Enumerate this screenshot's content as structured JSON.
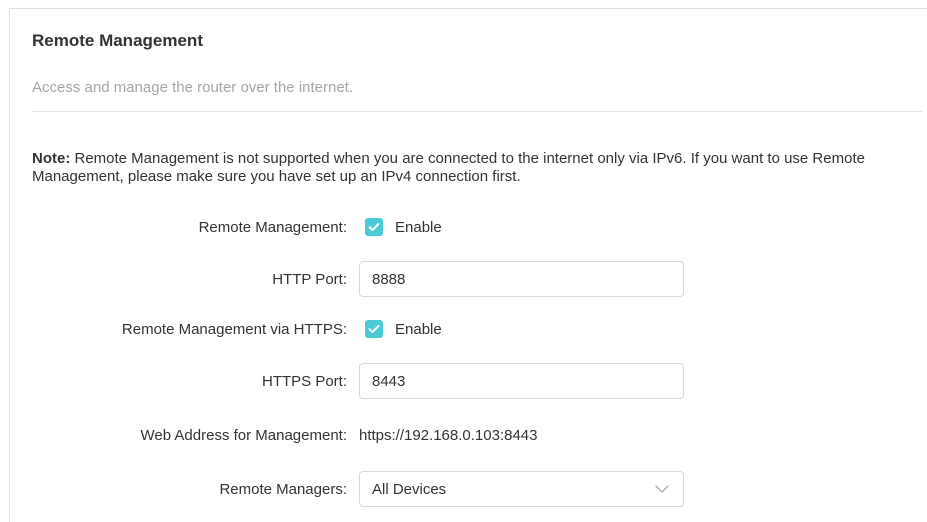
{
  "section": {
    "title": "Remote Management",
    "description": "Access and manage the router over the internet."
  },
  "note": {
    "label": "Note:",
    "text": " Remote Management is not supported when you are connected to the internet only via IPv6. If you want to use Remote Management, please make sure you have set up an IPv4 connection first."
  },
  "form": {
    "remote_management": {
      "label": "Remote Management:",
      "checked": true,
      "option_label": "Enable"
    },
    "http_port": {
      "label": "HTTP Port:",
      "value": "8888"
    },
    "remote_https": {
      "label": "Remote Management via HTTPS:",
      "checked": true,
      "option_label": "Enable"
    },
    "https_port": {
      "label": "HTTPS Port:",
      "value": "8443"
    },
    "web_address": {
      "label": "Web Address for Management:",
      "value": "https://192.168.0.103:8443"
    },
    "remote_managers": {
      "label": "Remote Managers:",
      "selected": "All Devices"
    }
  },
  "icons": {
    "checkbox": "check-icon",
    "dropdown": "chevron-down-icon"
  },
  "colors": {
    "accent": "#4acbd6",
    "muted_text": "#a6a6a6",
    "text": "#333333",
    "border": "#d9d9d9"
  }
}
